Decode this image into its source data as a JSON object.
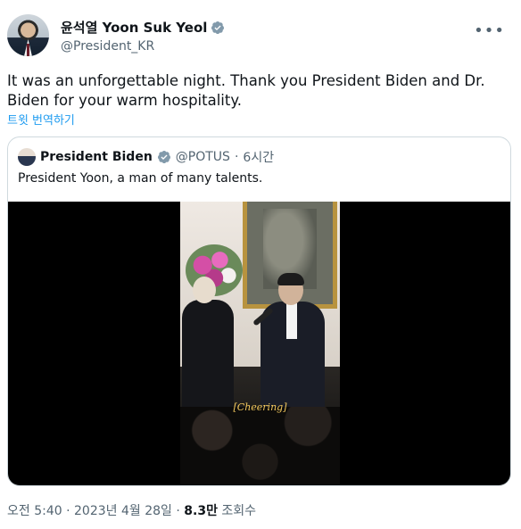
{
  "author": {
    "name": "윤석열 Yoon Suk Yeol",
    "handle": "@President_KR",
    "verified": true
  },
  "tweet": {
    "text": "It was an unforgettable night. Thank you President Biden and Dr. Biden for your warm hospitality.",
    "translate_label": "트윗 번역하기"
  },
  "quoted_tweet": {
    "name": "President Biden",
    "handle": "@POTUS",
    "separator": "·",
    "time": "6시간",
    "text": "President Yoon, a man of many talents.",
    "video_caption": "[Cheering]"
  },
  "footer": {
    "time": "오전 5:40",
    "sep1": "·",
    "date": "2023년 4월 28일",
    "sep2": "·",
    "views_count": "8.3만",
    "views_label": "조회수"
  },
  "colors": {
    "link": "#1d9bf0",
    "verified": "#829aab",
    "muted_text": "#536471"
  },
  "icons": {
    "more": "more-icon",
    "verified": "verified-badge-icon"
  }
}
